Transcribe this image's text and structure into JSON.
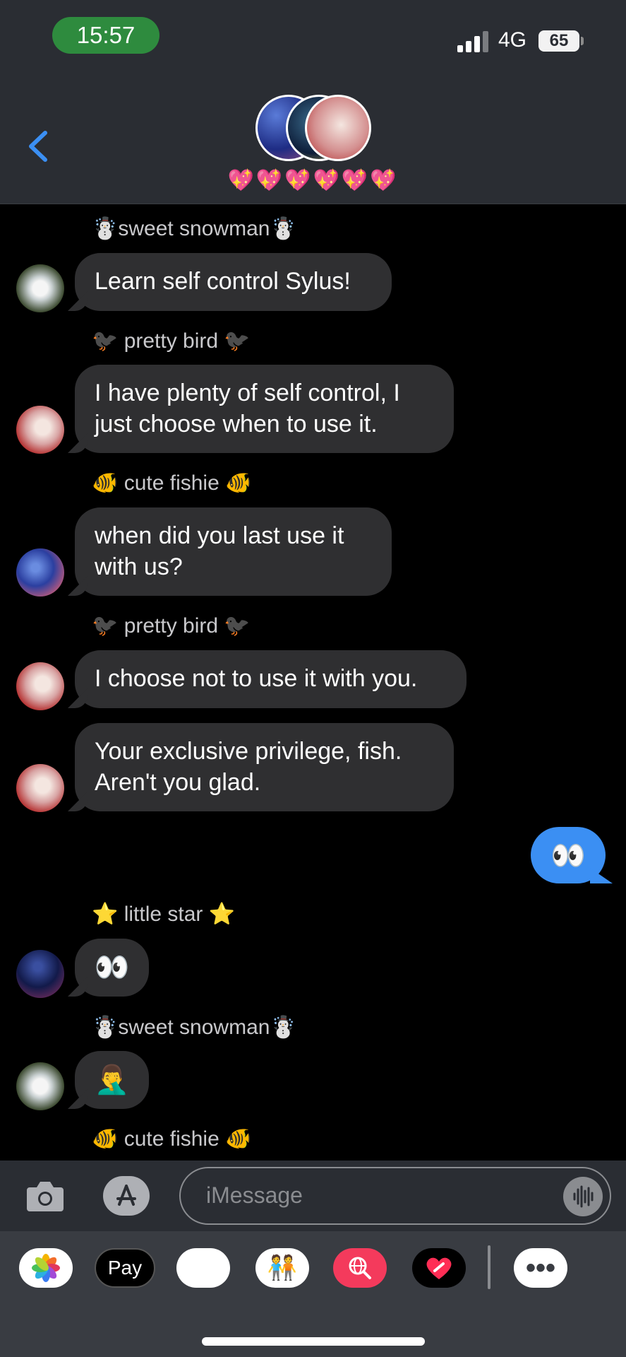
{
  "status_bar": {
    "time": "15:57",
    "network": "4G",
    "battery": "65"
  },
  "header": {
    "group_name": "💖💖💖💖💖💖"
  },
  "messages": [
    {
      "sender": "☃️sweet snowman☃️",
      "text": "Learn self control Sylus!"
    },
    {
      "sender": "🐦‍⬛ pretty bird 🐦‍⬛",
      "text_lines": [
        "I have plenty of self control, I",
        "just choose when to use it."
      ]
    },
    {
      "sender": "🐠 cute fishie 🐠",
      "text_lines": [
        "when did you last use it",
        "with us?"
      ]
    },
    {
      "sender": "🐦‍⬛ pretty bird 🐦‍⬛",
      "text": "I choose not to use it with you."
    },
    {
      "text_lines": [
        "Your exclusive privilege, fish.",
        "Aren't you glad."
      ]
    },
    {
      "outgoing": true,
      "text": "👀"
    },
    {
      "sender": "⭐ little star ⭐",
      "text": "👀"
    },
    {
      "sender": "☃️sweet snowman☃️",
      "text": "🤦‍♂️"
    },
    {
      "sender": "🐠 cute fishie 🐠"
    }
  ],
  "input": {
    "placeholder": "iMessage"
  },
  "drawer": {
    "pay_label": "Pay",
    "apple_symbol": "",
    "animoji": "🐵",
    "memoji": "🧑‍🤝‍🧑",
    "more": "•••"
  },
  "icons": {
    "back": "chevron-left-icon",
    "camera": "camera-icon",
    "apps": "app-store-icon",
    "mic": "audio-waveform-icon",
    "photos": "photos-app-icon",
    "search": "image-search-icon",
    "digital_touch": "digital-touch-heart-icon"
  },
  "colors": {
    "accent_blue": "#3b8ff3",
    "incoming_bubble": "#2f2f31",
    "header_bg": "#2a2d33",
    "time_pill": "#2e8b3e"
  }
}
